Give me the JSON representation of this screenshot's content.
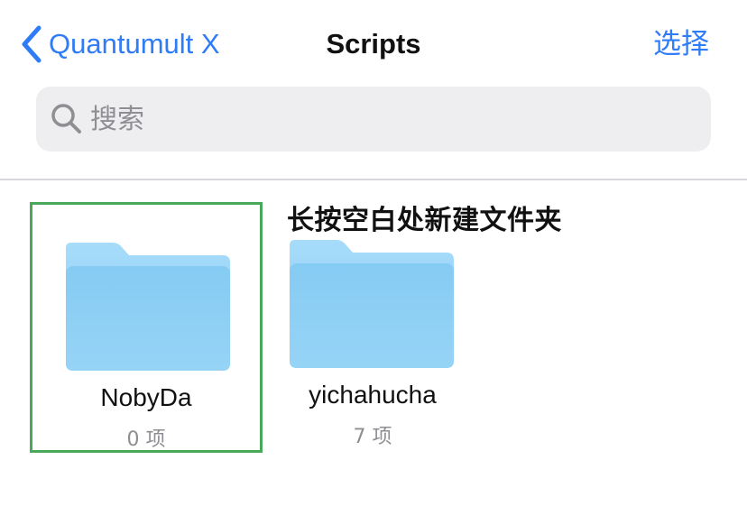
{
  "navbar": {
    "back_label": "Quantumult X",
    "title": "Scripts",
    "select_label": "选择"
  },
  "search": {
    "placeholder": "搜索",
    "value": ""
  },
  "hint": "长按空白处新建文件夹",
  "folders": [
    {
      "name": "NobyDa",
      "count": "0 项",
      "selected": true
    },
    {
      "name": "yichahucha",
      "count": "7 项",
      "selected": false
    }
  ],
  "colors": {
    "accent": "#2f7cf6",
    "folder_back": "#8fd0f6",
    "folder_front": "#8acdf3",
    "selection_border": "#4aa85a"
  },
  "icons": [
    "chevron-left-icon",
    "search-icon",
    "folder-icon"
  ]
}
